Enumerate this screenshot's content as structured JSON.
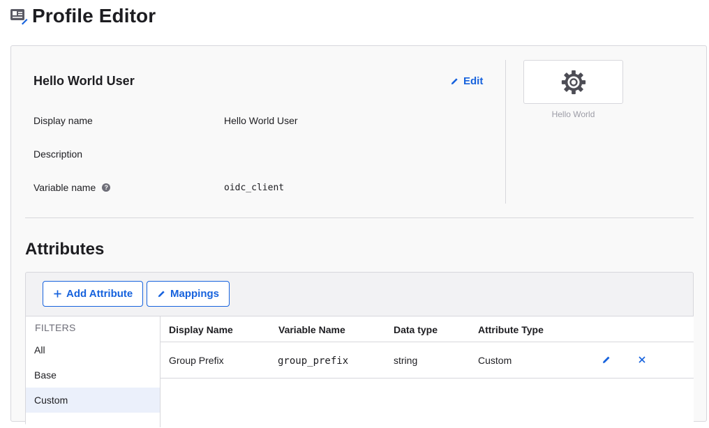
{
  "page": {
    "title": "Profile Editor",
    "header_icon": "profile-card-icon"
  },
  "app": {
    "name": "Hello World User",
    "edit_label": "Edit",
    "logo_caption": "Hello World",
    "logo_icon": "gear-icon"
  },
  "fields": [
    {
      "label": "Display name",
      "value": "Hello World User"
    },
    {
      "label": "Description",
      "value": ""
    },
    {
      "label": "Variable name",
      "value": "oidc_client",
      "help_icon": "?"
    }
  ],
  "attributes": {
    "title": "Attributes",
    "add_label": "Add Attribute",
    "mappings_label": "Mappings",
    "filters_title": "FILTERS",
    "filters": [
      "All",
      "Base",
      "Custom"
    ],
    "active_filter": "Custom",
    "columns": [
      "Display Name",
      "Variable Name",
      "Data type",
      "Attribute Type"
    ],
    "rows": [
      {
        "display_name": "Group Prefix",
        "variable_name": "group_prefix",
        "data_type": "string",
        "attribute_type": "Custom"
      }
    ]
  },
  "colors": {
    "accent": "#1662dd",
    "border": "#d7d7dc",
    "panel": "#f9f9f9",
    "active_filter_bg": "#ebf0fb"
  }
}
